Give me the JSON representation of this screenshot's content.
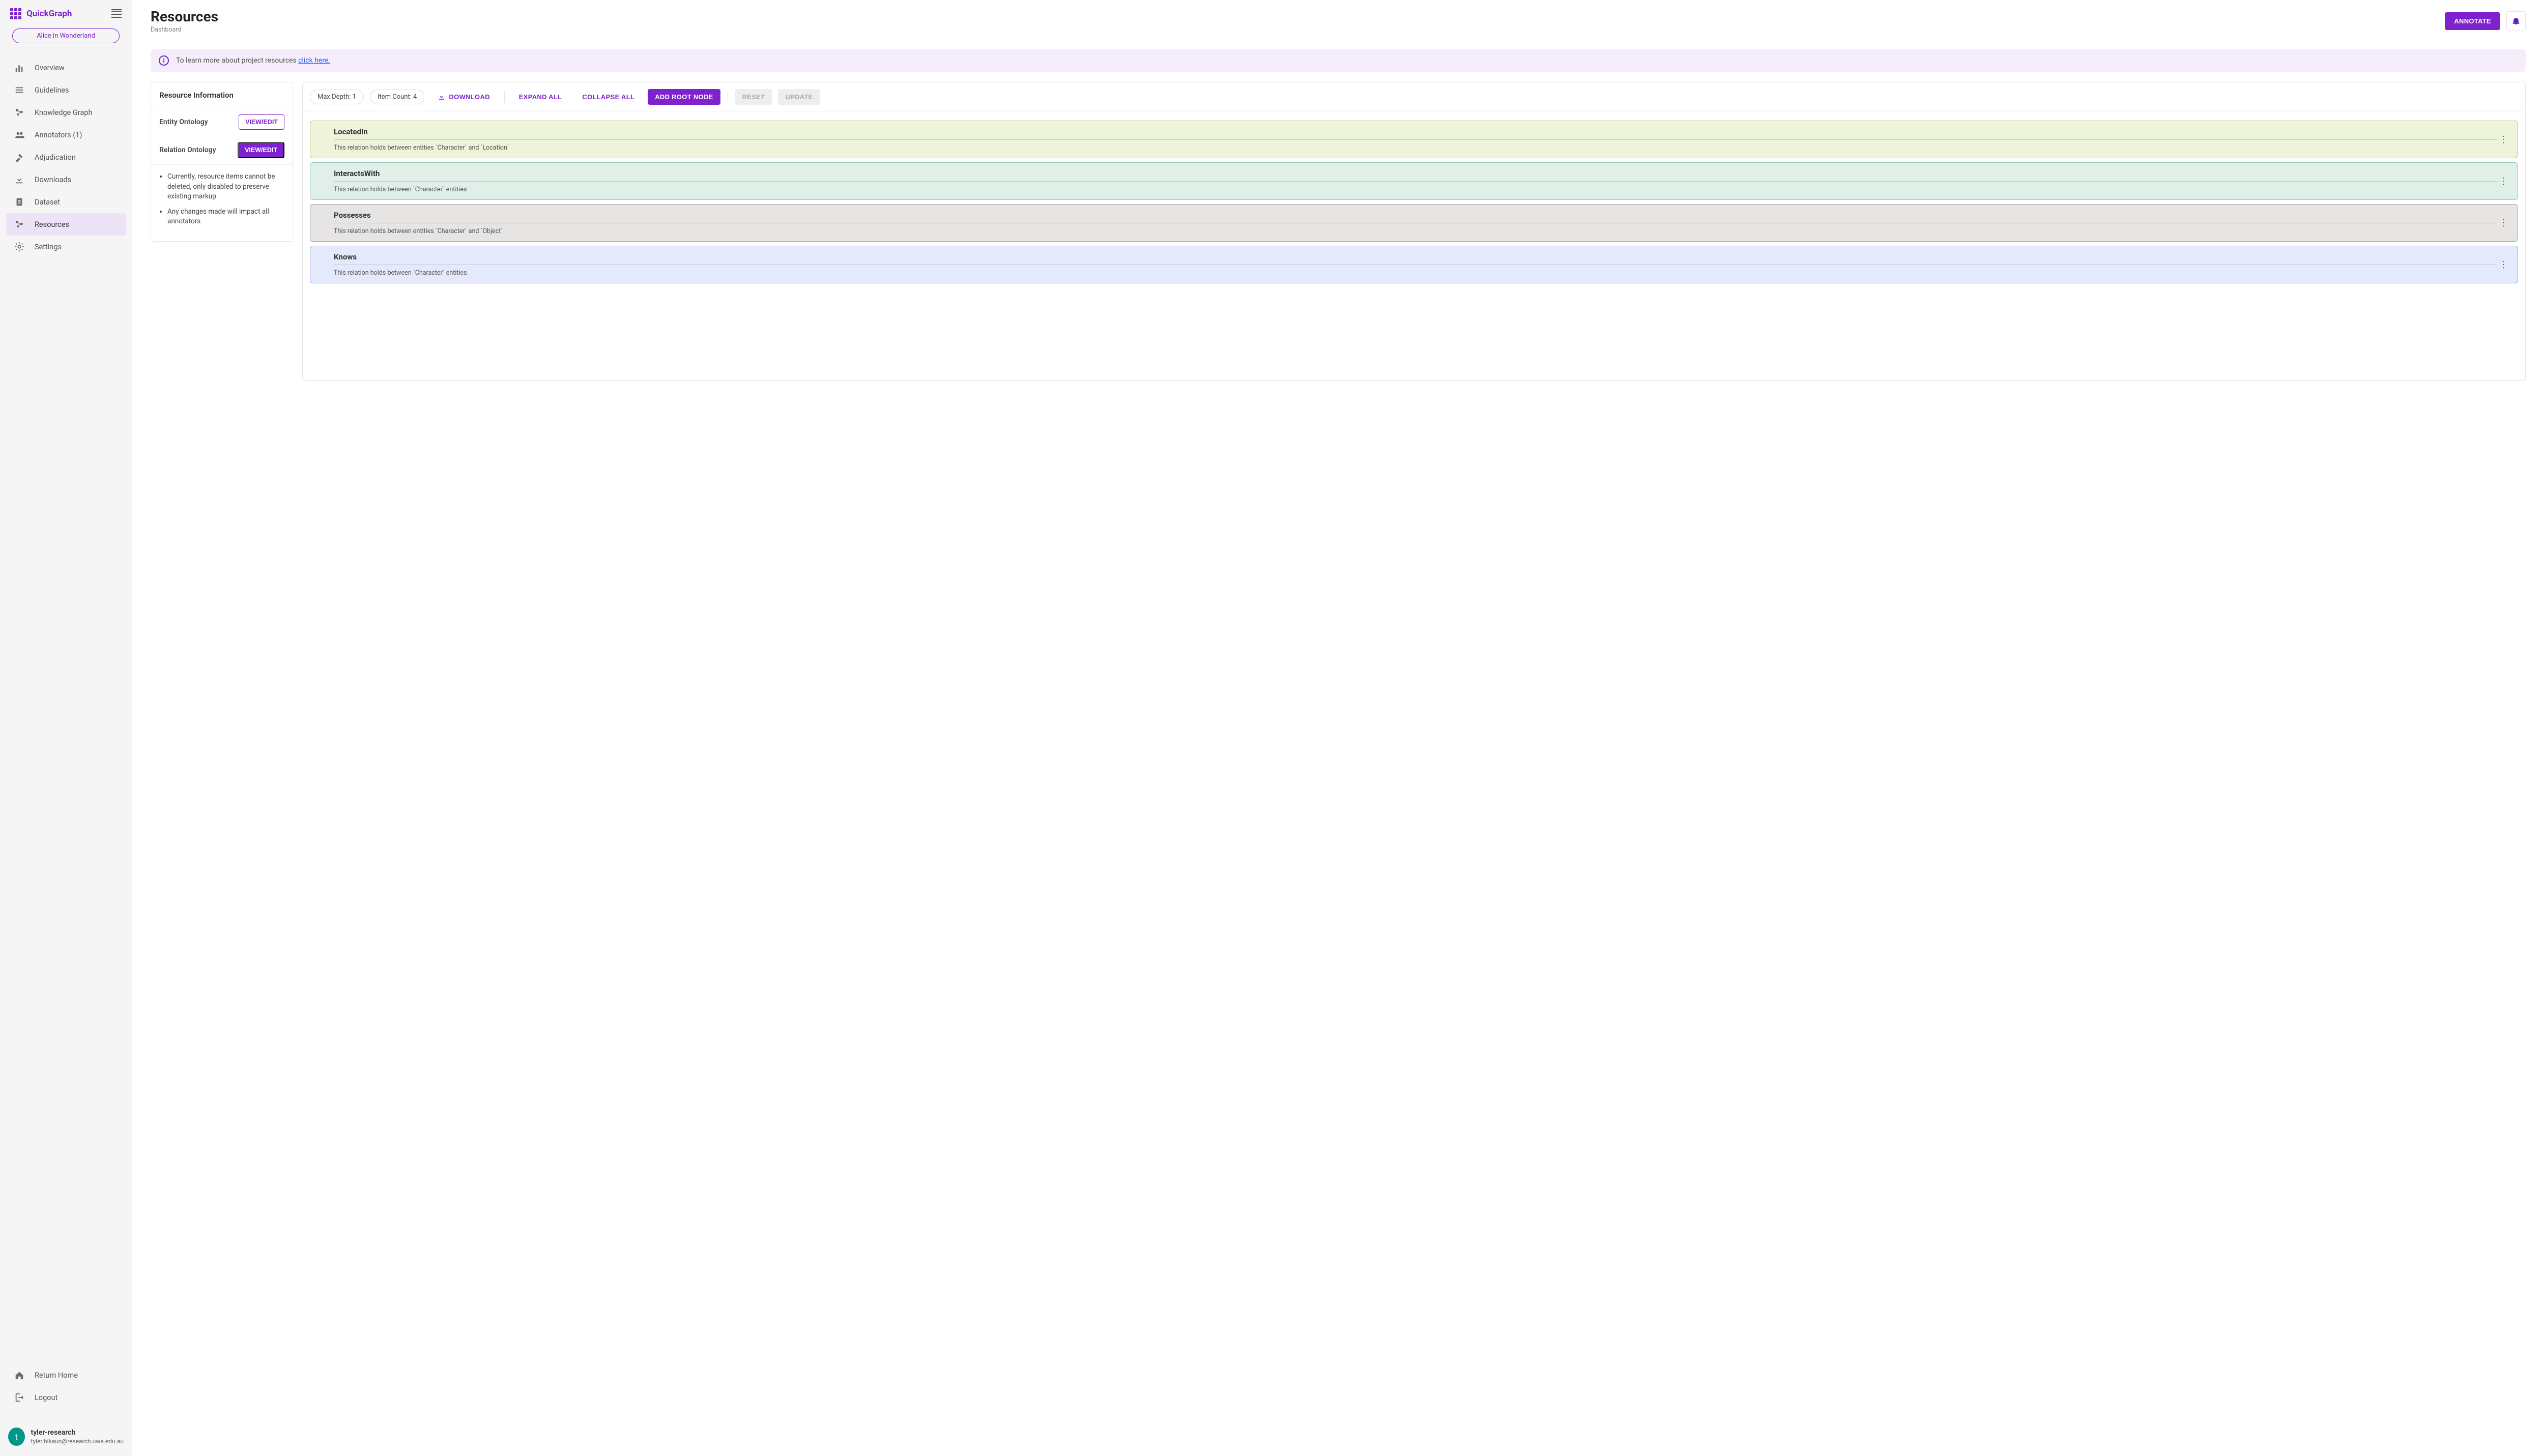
{
  "brand": "QuickGraph",
  "project_badge": "Alice in Wonderland",
  "sidebar": {
    "items": [
      {
        "label": "Overview",
        "icon": "bar-chart"
      },
      {
        "label": "Guidelines",
        "icon": "guidelines"
      },
      {
        "label": "Knowledge Graph",
        "icon": "graph"
      },
      {
        "label": "Annotators (1)",
        "icon": "people"
      },
      {
        "label": "Adjudication",
        "icon": "gavel"
      },
      {
        "label": "Downloads",
        "icon": "download"
      },
      {
        "label": "Dataset",
        "icon": "doc"
      },
      {
        "label": "Resources",
        "icon": "graph",
        "active": true
      },
      {
        "label": "Settings",
        "icon": "gear"
      }
    ],
    "bottom": [
      {
        "label": "Return Home",
        "icon": "home"
      },
      {
        "label": "Logout",
        "icon": "logout"
      }
    ]
  },
  "user": {
    "initial": "t",
    "name": "tyler-research",
    "email": "tyler.bikaun@research.uwa.edu.au"
  },
  "header": {
    "title": "Resources",
    "crumb": "Dashboard",
    "annotate_label": "ANNOTATE"
  },
  "banner": {
    "text_prefix": "To learn more about project resources ",
    "link_text": "click here."
  },
  "resource_info": {
    "heading": "Resource Information",
    "rows": [
      {
        "label": "Entity Ontology",
        "button": "VIEW/EDIT",
        "style": "outline"
      },
      {
        "label": "Relation Ontology",
        "button": "VIEW/EDIT",
        "style": "filled"
      }
    ],
    "notes": [
      "Currently, resource items cannot be deleted, only disabled to preserve existing markup",
      "Any changes made will impact all annotators"
    ]
  },
  "tree_toolbar": {
    "max_depth_label": "Max Depth: 1",
    "item_count_label": "Item Count: 4",
    "download": "DOWNLOAD",
    "expand": "EXPAND ALL",
    "collapse": "COLLAPSE ALL",
    "add_root": "ADD ROOT NODE",
    "reset": "RESET",
    "update": "UPDATE"
  },
  "relations": [
    {
      "name": "LocatedIn",
      "desc": "This relation holds between entities `Character` and `Location`",
      "color": "c-green"
    },
    {
      "name": "InteractsWith",
      "desc": "This relation holds between `Character` entities",
      "color": "c-teal"
    },
    {
      "name": "Possesses",
      "desc": "This relation holds between entities `Character` and `Object`",
      "color": "c-gray"
    },
    {
      "name": "Knows",
      "desc": "This relation holds between `Character` entities",
      "color": "c-blue"
    }
  ]
}
